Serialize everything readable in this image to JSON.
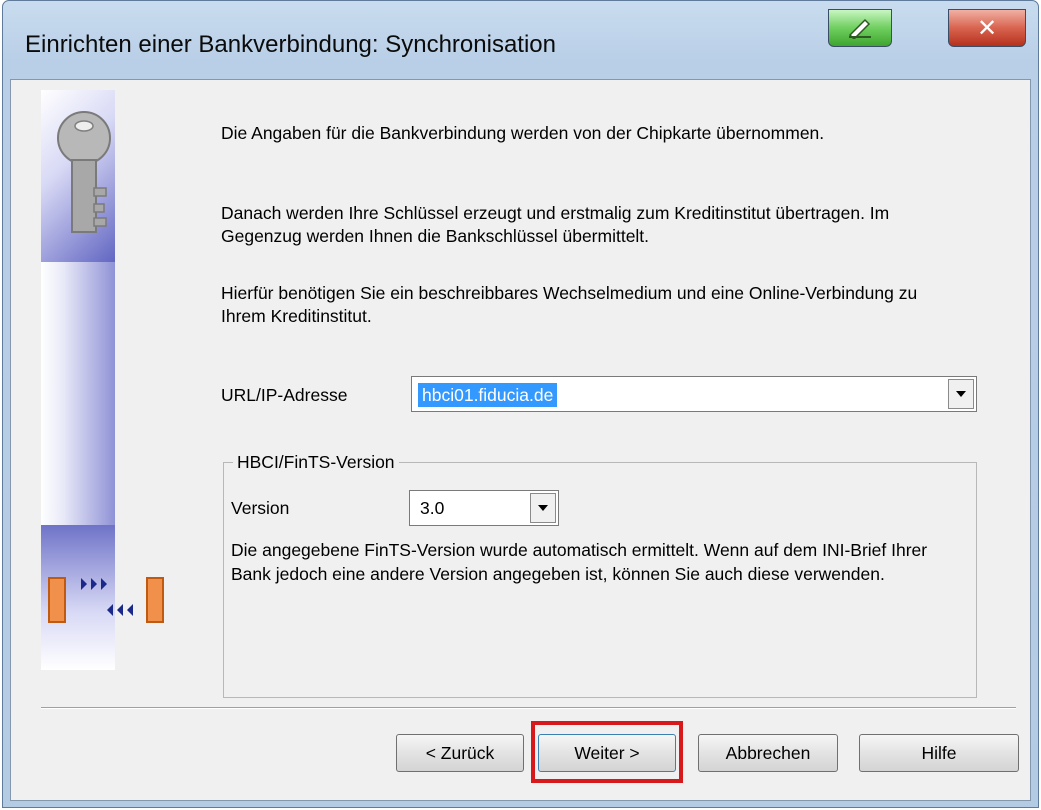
{
  "window": {
    "title": "Einrichten einer Bankverbindung: Synchronisation"
  },
  "intro": {
    "line1": "Die Angaben für die Bankverbindung werden von der Chipkarte übernommen.",
    "line2": "Danach werden Ihre Schlüssel erzeugt und erstmalig zum Kreditinstitut übertragen. Im Gegenzug werden Ihnen die Bankschlüssel übermittelt.",
    "line3": "Hierfür benötigen Sie ein beschreibbares Wechselmedium und eine Online-Verbindung zu Ihrem Kreditinstitut."
  },
  "url": {
    "label": "URL/IP-Adresse",
    "value": "hbci01.fiducia.de"
  },
  "version_group": {
    "title": "HBCI/FinTS-Version",
    "version_label": "Version",
    "version_value": "3.0",
    "note": "Die angegebene FinTS-Version wurde automatisch ermittelt. Wenn auf dem INI-Brief Ihrer Bank jedoch eine andere Version angegeben ist, können Sie auch diese verwenden."
  },
  "buttons": {
    "back": "< Zurück",
    "next": "Weiter >",
    "cancel": "Abbrechen",
    "help": "Hilfe"
  },
  "icons": {
    "help": "help-pen-icon",
    "close": "close-x-icon",
    "key": "key-icon",
    "sync": "sync-arrows-icon"
  },
  "colors": {
    "selection": "#3399ff",
    "highlight": "#d7191c",
    "close": "#c8412d",
    "help": "#5cc24b"
  }
}
